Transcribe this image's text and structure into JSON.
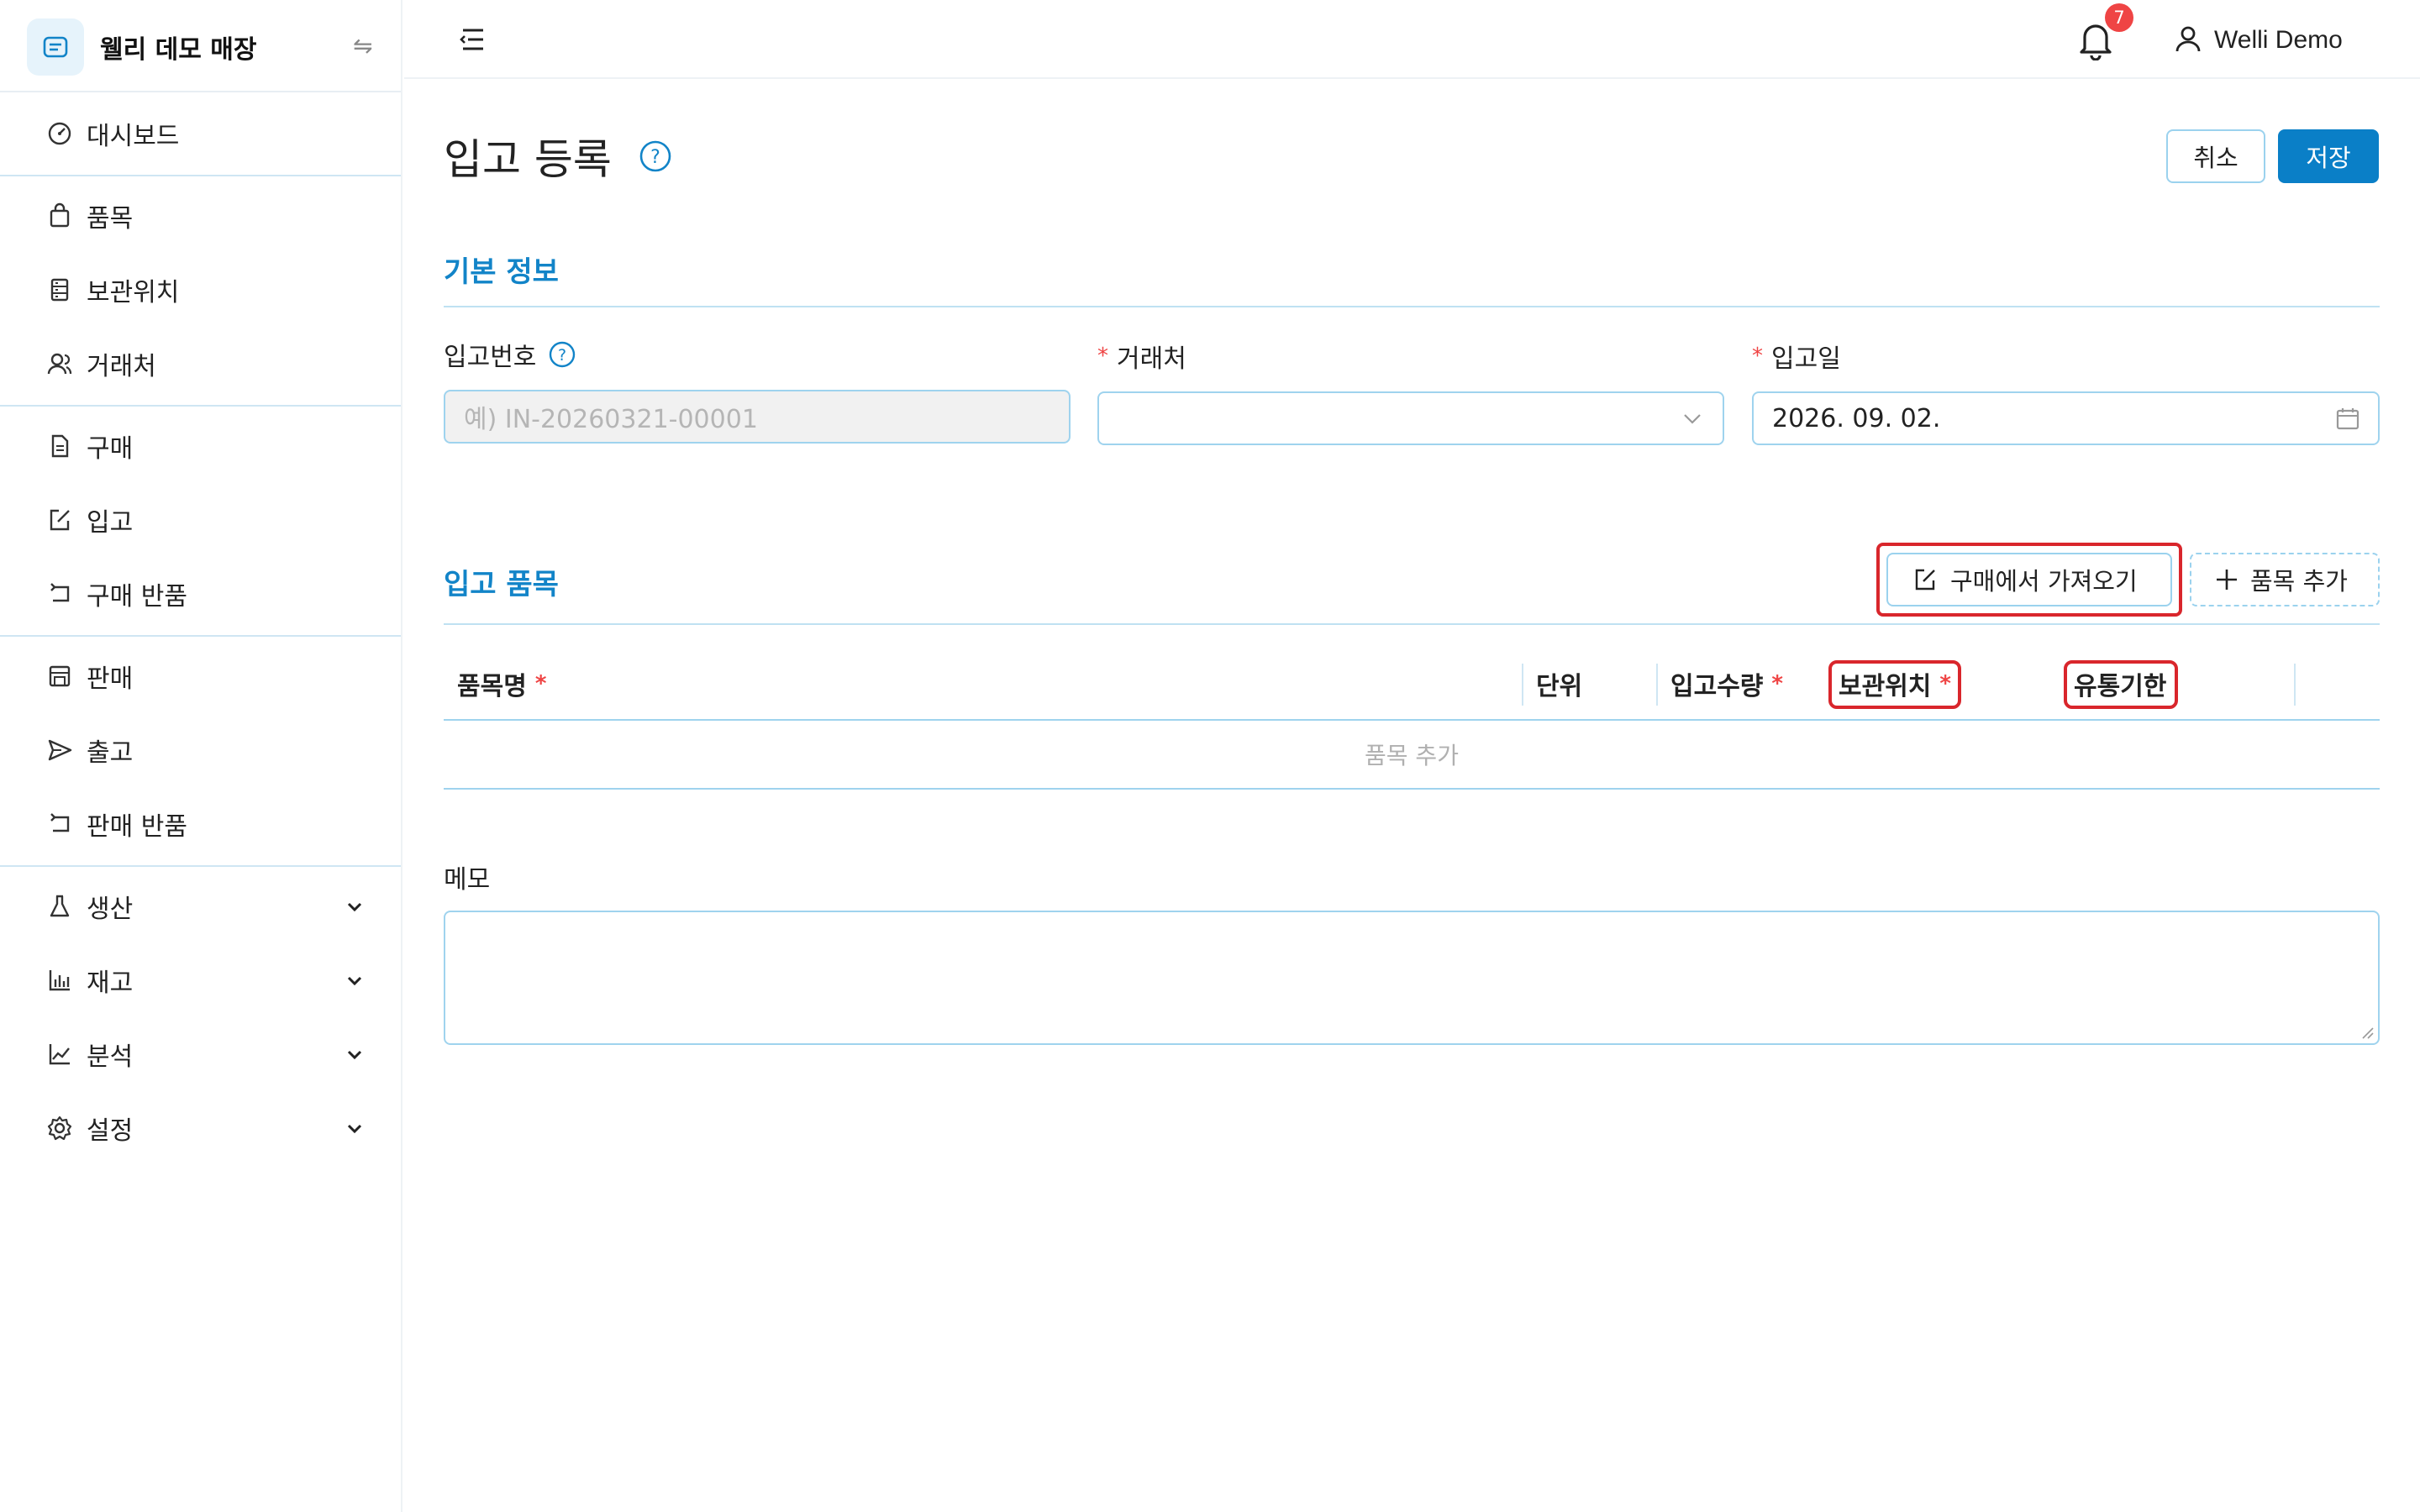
{
  "brand": {
    "name": "웰리 데모 매장",
    "switch_icon": "swap-icon",
    "accent": "#1284c8"
  },
  "sidebar": {
    "items": [
      {
        "label": "대시보드",
        "icon": "dashboard-icon"
      },
      {
        "label": "품목",
        "icon": "shopping-bag-icon"
      },
      {
        "label": "보관위치",
        "icon": "storage-icon"
      },
      {
        "label": "거래처",
        "icon": "partners-icon"
      },
      {
        "label": "구매",
        "icon": "document-icon"
      },
      {
        "label": "입고",
        "icon": "edit-square-icon"
      },
      {
        "label": "구매 반품",
        "icon": "return-icon"
      },
      {
        "label": "판매",
        "icon": "shop-icon"
      },
      {
        "label": "출고",
        "icon": "send-icon"
      },
      {
        "label": "판매 반품",
        "icon": "return-icon"
      },
      {
        "label": "생산",
        "icon": "flask-icon"
      },
      {
        "label": "재고",
        "icon": "bar-chart-icon"
      },
      {
        "label": "분석",
        "icon": "line-chart-icon"
      },
      {
        "label": "설정",
        "icon": "gear-icon"
      }
    ]
  },
  "header": {
    "notification_count": "7",
    "user_name": "Welli Demo"
  },
  "page": {
    "title": "입고 등록",
    "cancel_label": "취소",
    "save_label": "저장",
    "save_color": "#0a7fc7"
  },
  "basic_info": {
    "section_title": "기본 정보",
    "receipt_number": {
      "label": "입고번호",
      "placeholder": "예) IN-20260321-00001",
      "value": ""
    },
    "supplier": {
      "label": "거래처",
      "required_mark": "*",
      "value": ""
    },
    "receipt_date": {
      "label": "입고일",
      "required_mark": "*",
      "value": "2026. 09. 02."
    }
  },
  "items_section": {
    "section_title": "입고 품목",
    "import_button_label": "구매에서 가져오기",
    "add_item_label": "품목 추가",
    "columns": [
      {
        "label": "품목명",
        "required_mark": "*"
      },
      {
        "label": "단위",
        "required_mark": ""
      },
      {
        "label": "입고수량",
        "required_mark": "*"
      },
      {
        "label": "보관위치",
        "required_mark": "*"
      },
      {
        "label": "유통기한",
        "required_mark": ""
      }
    ],
    "empty_text": "품목 추가",
    "highlight_color": "#d9262c"
  },
  "memo": {
    "label": "메모",
    "value": ""
  }
}
